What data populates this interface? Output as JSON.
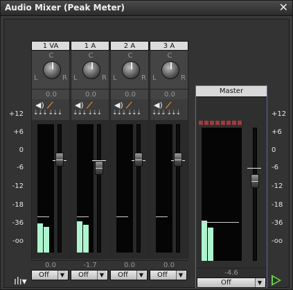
{
  "window": {
    "title": "Audio Mixer (Peak Meter)"
  },
  "scale_labels": [
    "+12",
    "+6",
    "0",
    "-6",
    "-12",
    "-18",
    "-36",
    "-oo"
  ],
  "channels": [
    {
      "name": "1 VA",
      "pan_center": "C",
      "pan_left": "L",
      "pan_right": "R",
      "pan_value": "0.0",
      "volume": "0.0",
      "output": "Off"
    },
    {
      "name": "1 A",
      "pan_center": "C",
      "pan_left": "L",
      "pan_right": "R",
      "pan_value": "0.0",
      "volume": "-1.7",
      "output": "Off"
    },
    {
      "name": "2 A",
      "pan_center": "C",
      "pan_left": "L",
      "pan_right": "R",
      "pan_value": "0.0",
      "volume": "0.0",
      "output": "Off"
    },
    {
      "name": "3 A",
      "pan_center": "C",
      "pan_left": "L",
      "pan_right": "R",
      "pan_value": "0.0",
      "volume": "0.0",
      "output": "Off"
    }
  ],
  "master": {
    "name": "Master",
    "volume": "-4.6",
    "output": "Off"
  },
  "icons": {
    "close": "close-icon",
    "speaker": "speaker-icon",
    "mute": "mute-icon",
    "menu": "mixer-menu-icon",
    "play": "play-icon"
  },
  "colors": {
    "meter_fill": "#aef5cf",
    "mute_accent": "#ff8c28",
    "master_border": "#5a6fa3",
    "play": "#6ad34a"
  }
}
